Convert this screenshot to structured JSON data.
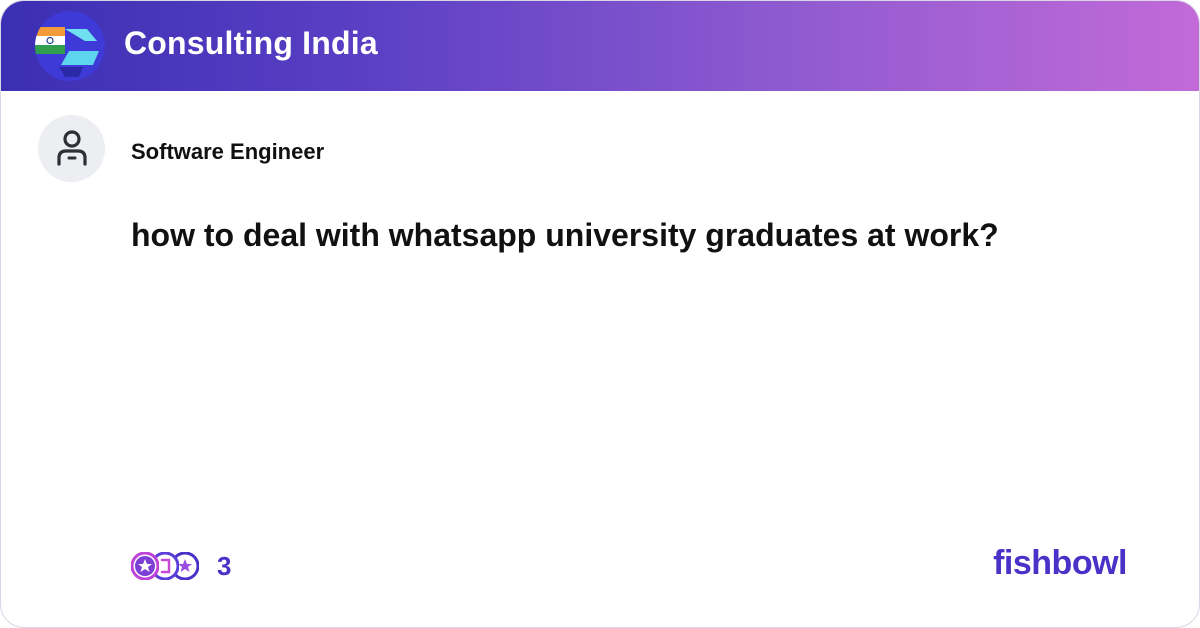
{
  "header": {
    "bowl_name": "Consulting India",
    "logo_icon": "bowl-logo-india-flag-icon",
    "gradient_colors": [
      "#3b2fb3",
      "#c26ad8"
    ]
  },
  "post": {
    "author_role": "Software Engineer",
    "avatar_icon": "user-avatar-icon",
    "title": "how to deal with whatsapp university graduates at work?"
  },
  "footer": {
    "reaction_icons": [
      "star-reaction-icon",
      "like-reaction-icon",
      "celebrate-reaction-icon"
    ],
    "reaction_count": "3",
    "brand": "fishbowl",
    "accent_color": "#4a32c8"
  }
}
